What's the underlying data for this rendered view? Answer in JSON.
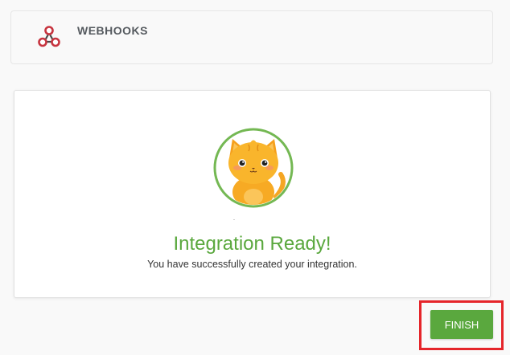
{
  "header": {
    "icon": "webhooks-icon",
    "title": "WEBHOOKS"
  },
  "main": {
    "mascot": "cat-mascot",
    "title": "Integration Ready!",
    "subtitle": "You have successfully created your integration."
  },
  "footer": {
    "finish_label": "FINISH"
  },
  "colors": {
    "accent_green": "#5aa83e",
    "highlight_red": "#e5252a",
    "icon_red": "#c7343f",
    "mascot_orange": "#f5a623"
  }
}
